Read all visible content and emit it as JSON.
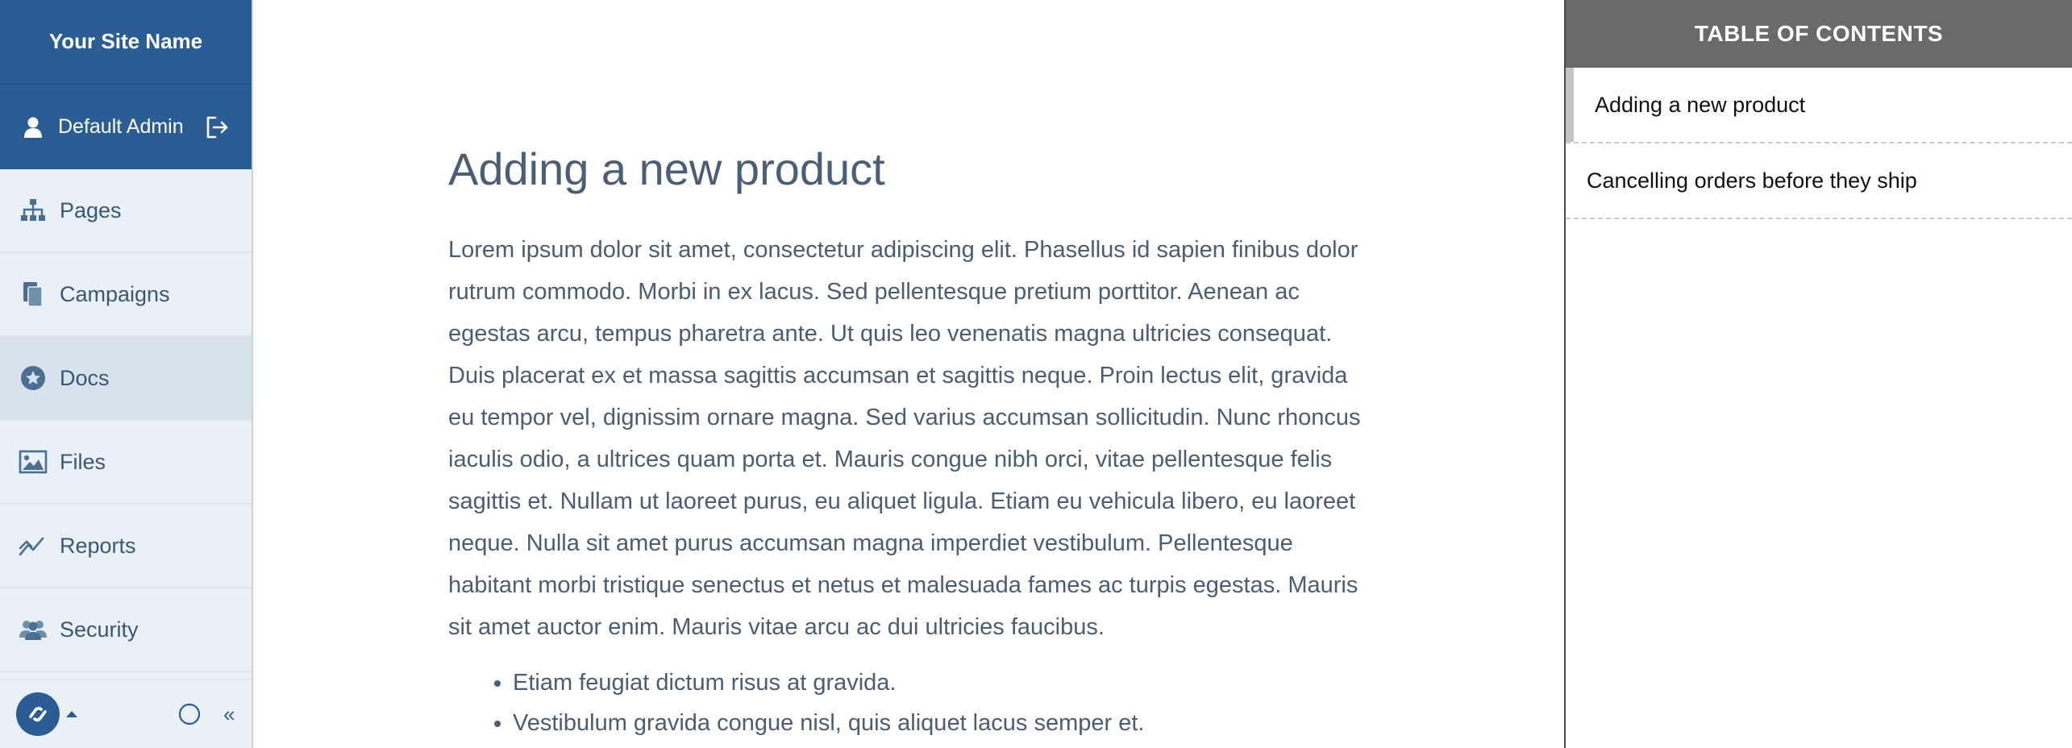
{
  "sidebar": {
    "site_name": "Your Site Name",
    "user_name": "Default Admin",
    "items": [
      {
        "label": "Pages",
        "icon": "sitemap-icon"
      },
      {
        "label": "Campaigns",
        "icon": "copy-icon"
      },
      {
        "label": "Docs",
        "icon": "star-circle-icon",
        "active": true
      },
      {
        "label": "Files",
        "icon": "image-icon"
      },
      {
        "label": "Reports",
        "icon": "line-chart-icon"
      },
      {
        "label": "Security",
        "icon": "users-icon"
      }
    ],
    "footer": {
      "icons": [
        "brand-logo",
        "caret-up-icon",
        "circle-icon",
        "double-chevron-left-icon"
      ],
      "collapse_glyph": "«"
    }
  },
  "main": {
    "title": "Adding a new product",
    "paragraph": "Lorem ipsum dolor sit amet, consectetur adipiscing elit. Phasellus id sapien finibus dolor rutrum commodo. Morbi in ex lacus. Sed pellentesque pretium porttitor. Aenean ac egestas arcu, tempus pharetra ante. Ut quis leo venenatis magna ultricies consequat. Duis placerat ex et massa sagittis accumsan et sagittis neque. Proin lectus elit, gravida eu tempor vel, dignissim ornare magna. Sed varius accumsan sollicitudin. Nunc rhoncus iaculis odio, a ultrices quam porta et. Mauris congue nibh orci, vitae pellentesque felis sagittis et. Nullam ut laoreet purus, eu aliquet ligula. Etiam eu vehicula libero, eu laoreet neque. Nulla sit amet purus accumsan magna imperdiet vestibulum. Pellentesque habitant morbi tristique senectus et netus et malesuada fames ac turpis egestas. Mauris sit amet auctor enim. Mauris vitae arcu ac dui ultricies faucibus.",
    "bullets": [
      "Etiam feugiat dictum risus at gravida.",
      "Vestibulum gravida congue nisl, quis aliquet lacus semper et."
    ]
  },
  "toc": {
    "title": "TABLE OF CONTENTS",
    "items": [
      {
        "label": "Adding a new product",
        "active": true
      },
      {
        "label": "Cancelling orders before they ship"
      }
    ]
  },
  "colors": {
    "brand": "#2b5d95",
    "sidebar_bg": "#e9f0f6",
    "toc_header": "#6a6a6a",
    "text": "#4b5d72"
  }
}
